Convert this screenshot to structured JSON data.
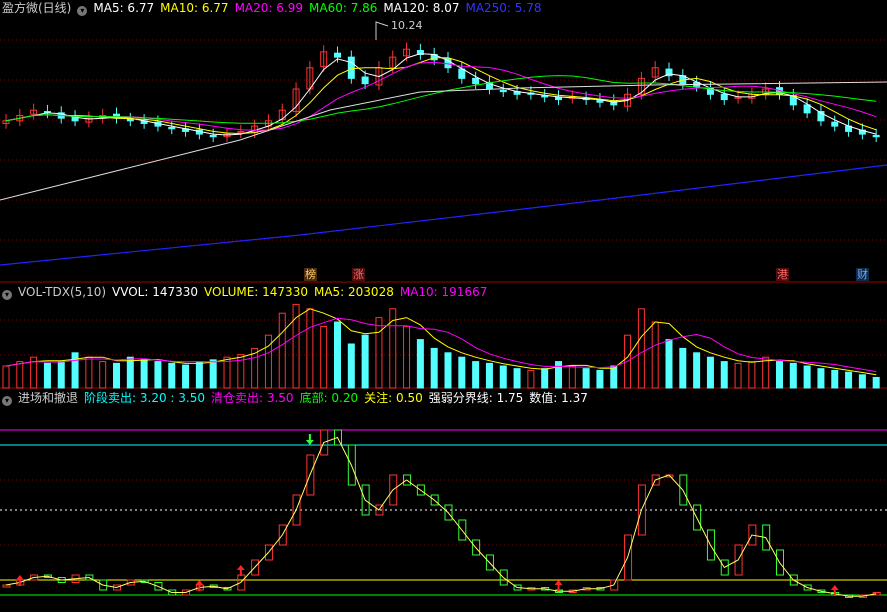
{
  "panel1": {
    "title": "盈方微(日线)",
    "indicators": [
      {
        "label": "MA5: 6.77",
        "color": "#ffffff"
      },
      {
        "label": "MA10: 6.77",
        "color": "#ffff00"
      },
      {
        "label": "MA20: 6.99",
        "color": "#ff00ff"
      },
      {
        "label": "MA60: 7.86",
        "color": "#00ff00"
      },
      {
        "label": "MA120: 8.07",
        "color": "#ffffff"
      },
      {
        "label": "MA250: 5.78",
        "color": "#3333ff"
      }
    ],
    "high_label": "10.24",
    "markers": [
      {
        "text": "榜",
        "bg": "#4a2a10",
        "color": "#ffcc66"
      },
      {
        "text": "涨",
        "bg": "#4a1010",
        "color": "#ff6666"
      },
      {
        "text": "港",
        "bg": "#4a1010",
        "color": "#ff6666"
      },
      {
        "text": "财",
        "bg": "#102a4a",
        "color": "#66aaff"
      }
    ]
  },
  "panel2": {
    "title": "VOL-TDX(5,10)",
    "indicators": [
      {
        "label": "VVOL: 147330",
        "color": "#ffffff"
      },
      {
        "label": "VOLUME: 147330",
        "color": "#ffff00"
      },
      {
        "label": "MA5: 203028",
        "color": "#ffff00"
      },
      {
        "label": "MA10: 191667",
        "color": "#ff00ff"
      }
    ]
  },
  "panel3": {
    "title": "进场和撤退",
    "indicators": [
      {
        "label": "阶段卖出: 3.20 : 3.50",
        "color": "#00ffff"
      },
      {
        "label": "清仓卖出: 3.50",
        "color": "#ff00ff"
      },
      {
        "label": "底部: 0.20",
        "color": "#00ff00"
      },
      {
        "label": "关注: 0.50",
        "color": "#ffff00"
      },
      {
        "label": "强弱分界线: 1.75",
        "color": "#ffffff"
      },
      {
        "label": "数值: 1.37",
        "color": "#ffffff"
      }
    ]
  },
  "chart_data": {
    "type": "candlestick",
    "price_seed": [
      6.6,
      6.8,
      7.0,
      6.9,
      6.7,
      6.6,
      6.7,
      6.8,
      6.7,
      6.6,
      6.5,
      6.4,
      6.3,
      6.2,
      6.1,
      6.0,
      6.1,
      6.2,
      6.4,
      6.6,
      7.0,
      7.8,
      8.6,
      9.2,
      9.0,
      8.2,
      8.0,
      8.6,
      9.0,
      9.3,
      9.1,
      8.9,
      8.6,
      8.2,
      8.0,
      7.8,
      7.7,
      7.6,
      7.6,
      7.5,
      7.4,
      7.5,
      7.4,
      7.3,
      7.2,
      7.6,
      8.2,
      8.6,
      8.3,
      8.0,
      7.9,
      7.6,
      7.4,
      7.5,
      7.6,
      7.8,
      7.6,
      7.2,
      6.9,
      6.6,
      6.4,
      6.2,
      6.1,
      6.0
    ],
    "volume_seed": [
      0.25,
      0.3,
      0.35,
      0.28,
      0.3,
      0.4,
      0.35,
      0.3,
      0.28,
      0.35,
      0.32,
      0.3,
      0.28,
      0.26,
      0.3,
      0.32,
      0.35,
      0.38,
      0.45,
      0.6,
      0.85,
      0.95,
      0.9,
      0.7,
      0.75,
      0.5,
      0.6,
      0.8,
      0.9,
      0.7,
      0.55,
      0.45,
      0.4,
      0.35,
      0.3,
      0.28,
      0.25,
      0.22,
      0.2,
      0.22,
      0.3,
      0.25,
      0.22,
      0.2,
      0.25,
      0.6,
      0.9,
      0.75,
      0.55,
      0.45,
      0.4,
      0.35,
      0.3,
      0.28,
      0.3,
      0.35,
      0.3,
      0.28,
      0.25,
      0.22,
      0.2,
      0.18,
      0.15,
      0.12
    ],
    "osc_seed": [
      0.4,
      0.5,
      0.6,
      0.55,
      0.45,
      0.6,
      0.5,
      0.3,
      0.4,
      0.5,
      0.45,
      0.3,
      0.2,
      0.3,
      0.4,
      0.35,
      0.3,
      0.6,
      0.9,
      1.2,
      1.6,
      2.2,
      3.0,
      3.5,
      3.2,
      2.4,
      1.8,
      2.0,
      2.6,
      2.4,
      2.2,
      2.0,
      1.7,
      1.3,
      1.0,
      0.7,
      0.4,
      0.3,
      0.35,
      0.3,
      0.25,
      0.3,
      0.35,
      0.3,
      0.5,
      1.4,
      2.4,
      2.6,
      2.6,
      2.0,
      1.5,
      0.9,
      0.6,
      1.2,
      1.6,
      1.1,
      0.6,
      0.4,
      0.3,
      0.25,
      0.2,
      0.15,
      0.2,
      0.25
    ]
  }
}
